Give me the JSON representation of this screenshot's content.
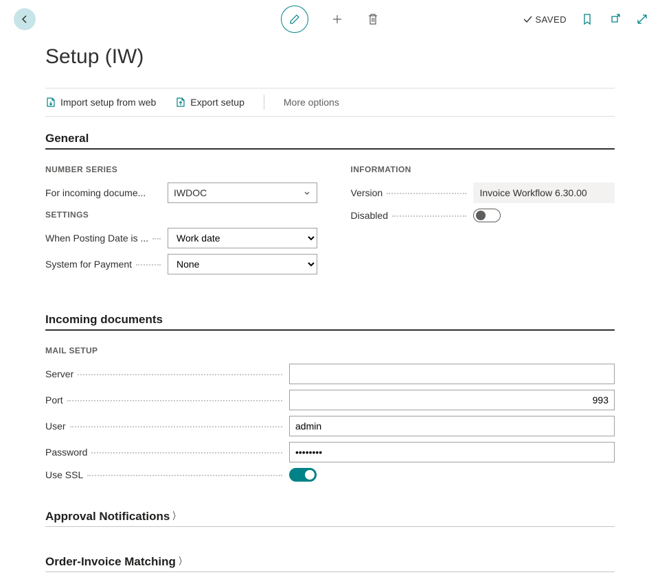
{
  "topbar": {
    "saved_label": "SAVED"
  },
  "page_title": "Setup (IW)",
  "actionbar": {
    "import_label": "Import setup from web",
    "export_label": "Export setup",
    "more_label": "More options"
  },
  "general": {
    "header": "General",
    "number_series_heading": "NUMBER SERIES",
    "incoming_doc_label": "For incoming docume...",
    "incoming_doc_value": "IWDOC",
    "settings_heading": "SETTINGS",
    "posting_date_label": "When Posting Date is ...",
    "posting_date_value": "Work date",
    "payment_label": "System for Payment",
    "payment_value": "None",
    "information_heading": "INFORMATION",
    "version_label": "Version",
    "version_value": "Invoice Workflow 6.30.00",
    "disabled_label": "Disabled",
    "disabled_value": false
  },
  "incoming_docs": {
    "header": "Incoming documents",
    "mail_setup_heading": "MAIL SETUP",
    "server_label": "Server",
    "server_value": "",
    "port_label": "Port",
    "port_value": "993",
    "user_label": "User",
    "user_value": "admin",
    "password_label": "Password",
    "password_value": "••••••••",
    "use_ssl_label": "Use SSL",
    "use_ssl_value": true
  },
  "approval_notifications": {
    "header": "Approval Notifications"
  },
  "order_invoice": {
    "header": "Order-Invoice Matching"
  }
}
